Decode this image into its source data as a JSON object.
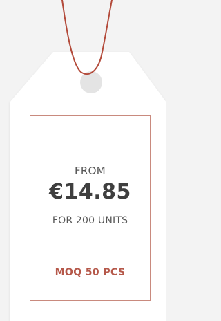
{
  "tag": {
    "from_label": "FROM",
    "price": "€14.85",
    "units_label": "FOR 200 UNITS",
    "moq_label": "MOQ 50 PCS"
  },
  "colors": {
    "background": "#f3f3f3",
    "tag": "#ffffff",
    "string": "#b34a3a",
    "border": "#c98a7e",
    "price_text": "#3f3f3f",
    "muted_text": "#555555",
    "accent_text": "#b5584a"
  }
}
